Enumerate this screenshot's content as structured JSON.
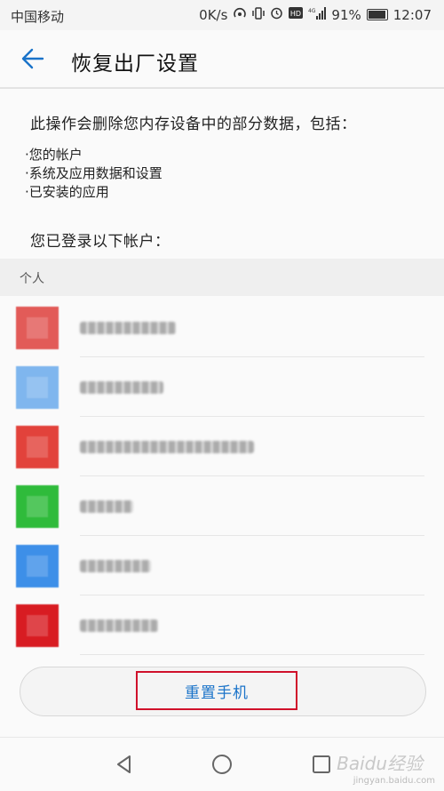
{
  "status_bar": {
    "carrier": "中国移动",
    "speed": "0K/s",
    "battery": "91%",
    "time": "12:07",
    "icons": [
      "hotspot-icon",
      "vibrate-icon",
      "alarm-icon",
      "hd-icon",
      "4g-signal-icon",
      "battery-icon"
    ]
  },
  "header": {
    "title": "恢复出厂设置",
    "back_icon": "back-arrow-icon"
  },
  "body": {
    "description": "此操作会删除您内存设备中的部分数据，包括：",
    "bullets": [
      "·您的帐户",
      "·系统及应用数据和设置",
      "·已安装的应用"
    ],
    "logged_in_label": "您已登录以下帐户："
  },
  "section_label": "个人",
  "accounts": [
    {
      "avatar_color": "#e25b58"
    },
    {
      "avatar_color": "#7fb6ee"
    },
    {
      "avatar_color": "#e2423b"
    },
    {
      "avatar_color": "#2fbb3b"
    },
    {
      "avatar_color": "#3d8fe8"
    },
    {
      "avatar_color": "#d81c22"
    }
  ],
  "reset_button": "重置手机",
  "navbar": {
    "icons": [
      "back-triangle-icon",
      "home-circle-icon",
      "recents-square-icon"
    ]
  },
  "watermark": {
    "brand": "Baidu经验",
    "url": "jingyan.baidu.com"
  },
  "colors": {
    "accent": "#1a73c9",
    "highlight_box": "#d0112b"
  }
}
